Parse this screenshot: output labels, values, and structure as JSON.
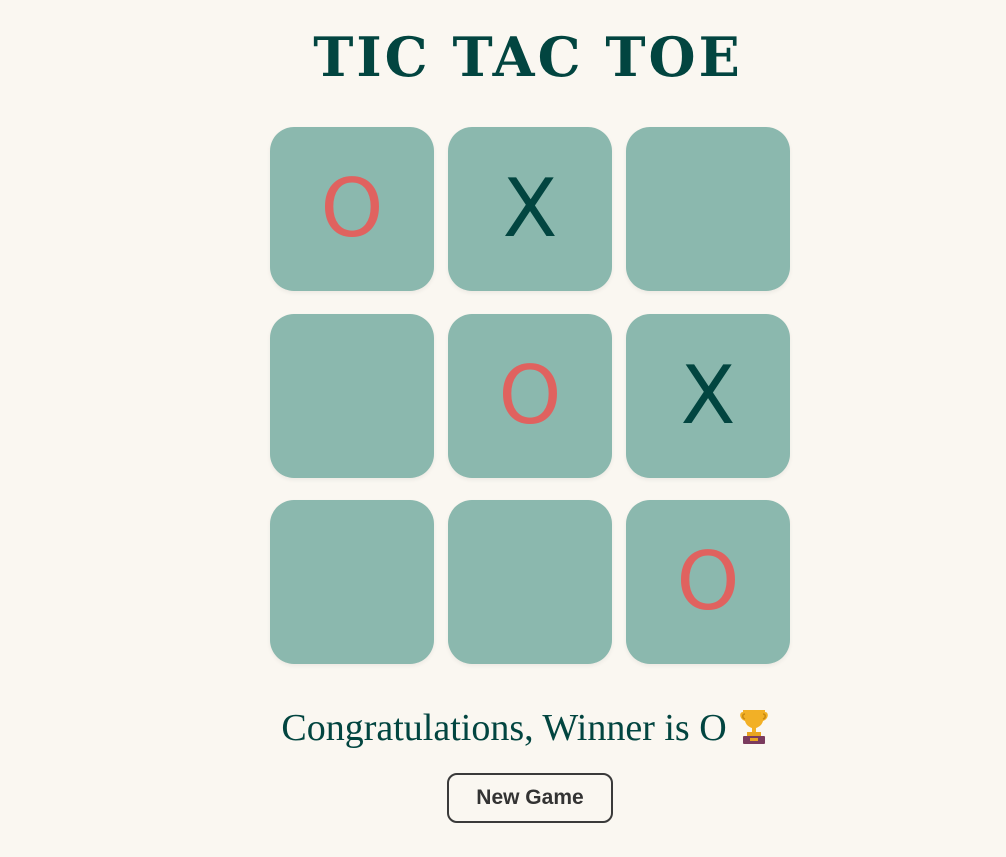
{
  "title": "TIC TAC TOE",
  "board": {
    "cells": [
      "O",
      "X",
      "",
      "",
      "O",
      "X",
      "",
      "",
      "O"
    ]
  },
  "status": {
    "message": "Congratulations, Winner is O",
    "icon": "trophy-icon"
  },
  "new_game_button": {
    "label": "New Game"
  },
  "colors": {
    "background": "#faf7f1",
    "title": "#024540",
    "cell": "#8bb8ae",
    "x_mark": "#024540",
    "o_mark": "#e0625f",
    "button_border": "#3a3a3a"
  }
}
